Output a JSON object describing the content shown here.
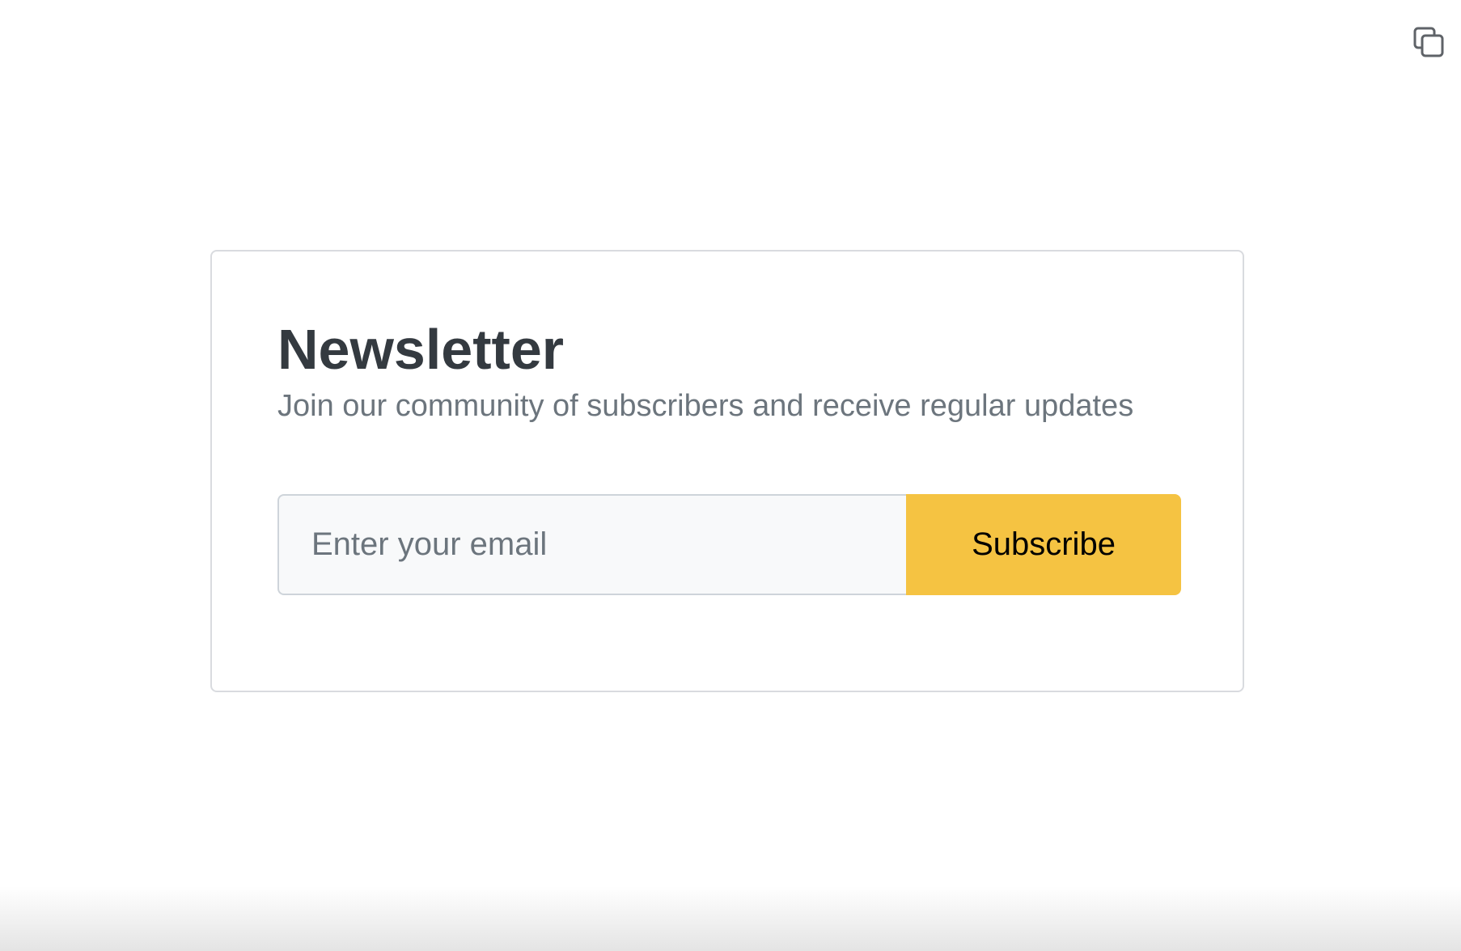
{
  "toolbar": {
    "copy_icon": "copy-icon"
  },
  "newsletter": {
    "title": "Newsletter",
    "subtitle": "Join our community of subscribers and receive regular updates",
    "email": {
      "placeholder": "Enter your email",
      "value": ""
    },
    "subscribe_label": "Subscribe"
  },
  "colors": {
    "accent": "#f5c342",
    "title": "#343a40",
    "muted": "#6c757d",
    "border": "#d9dbdf",
    "input_bg": "#f8f9fa"
  }
}
